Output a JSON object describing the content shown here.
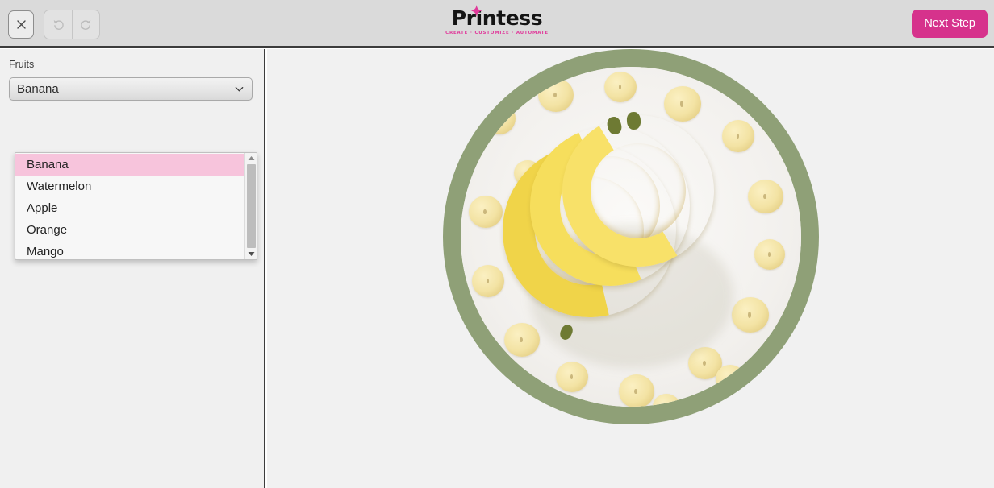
{
  "header": {
    "close_label": "×",
    "close_icon": "close-icon",
    "undo_icon": "undo-icon",
    "redo_icon": "redo-icon",
    "next_step_label": "Next Step",
    "next_step_color": "#d6328c",
    "background_color": "#dadada"
  },
  "logo": {
    "word": "Printess",
    "tagline": "CREATE · CUSTOMIZE · AUTOMATE",
    "accent_color": "#e0399a",
    "star_icon": "sparkle-icon"
  },
  "sidebar": {
    "field_label": "Fruits",
    "select": {
      "value": "Banana",
      "chevron_icon": "chevron-down-icon"
    },
    "dropdown": {
      "options": [
        "Banana",
        "Watermelon",
        "Apple",
        "Orange",
        "Mango"
      ],
      "selected_index": 0,
      "highlight_color": "#f7c4dc",
      "scroll_up_icon": "scroll-up-arrow-icon",
      "scroll_down_icon": "scroll-down-arrow-icon"
    }
  },
  "canvas": {
    "background_color": "#f1f1f1",
    "artwork": {
      "name": "banana-circle-artwork",
      "ring_color": "#8fa077",
      "description": "Bananas and banana slices in a circular frame"
    }
  }
}
